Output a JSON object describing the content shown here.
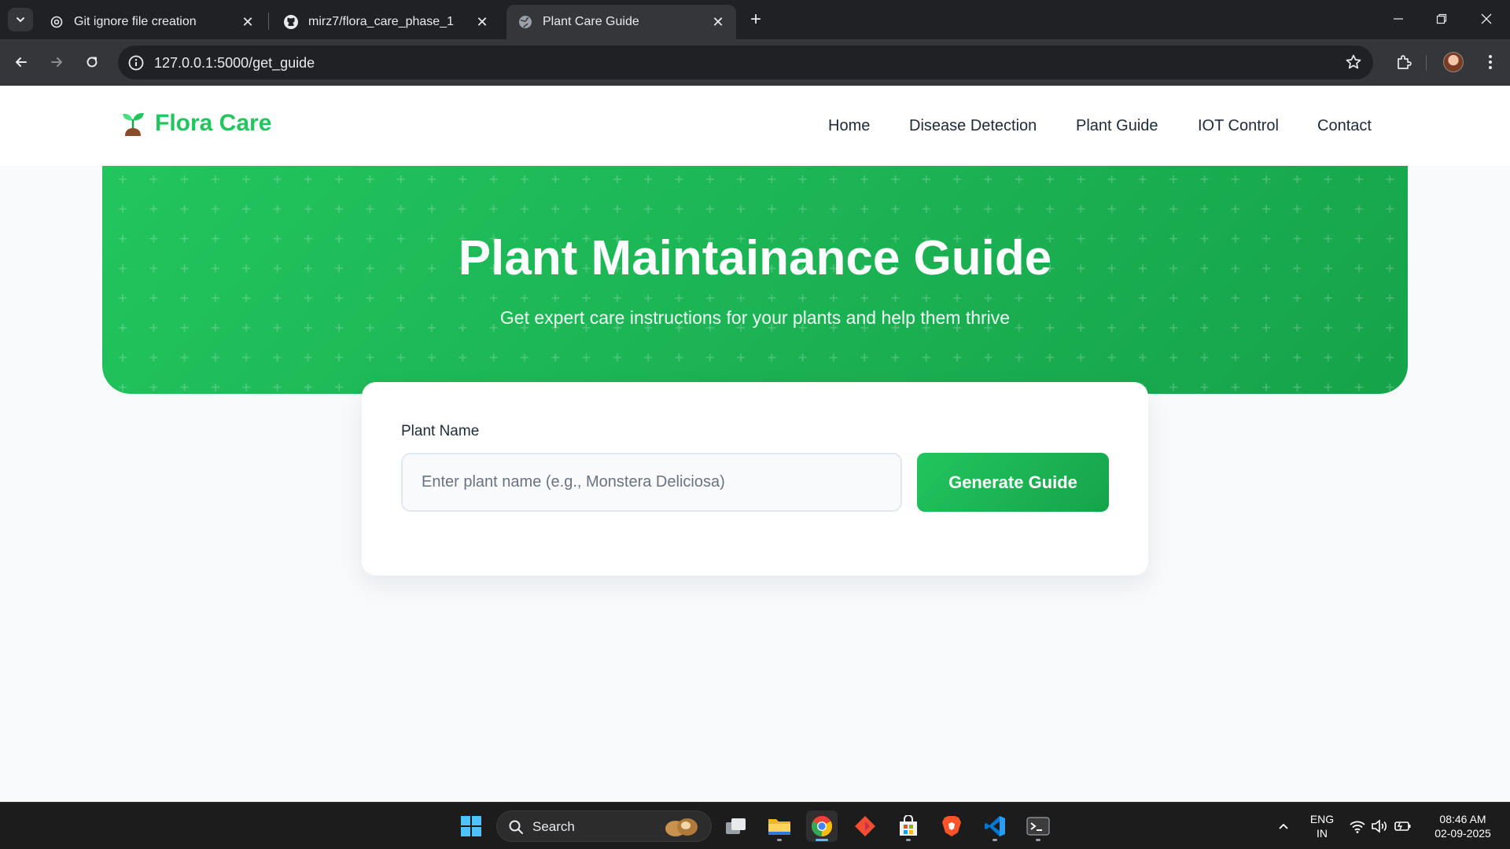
{
  "browser": {
    "tabs": [
      {
        "label": "Git ignore file creation",
        "icon": "openai-icon",
        "active": false
      },
      {
        "label": "mirz7/flora_care_phase_1",
        "icon": "github-icon",
        "active": false
      },
      {
        "label": "Plant Care Guide",
        "icon": "globe-icon",
        "active": true
      }
    ],
    "url": "127.0.0.1:5000/get_guide"
  },
  "site": {
    "brand": "Flora Care",
    "nav": [
      "Home",
      "Disease Detection",
      "Plant Guide",
      "IOT Control",
      "Contact"
    ],
    "hero": {
      "title": "Plant Maintainance Guide",
      "subtitle": "Get expert care instructions for your plants and help them thrive"
    },
    "form": {
      "label": "Plant Name",
      "placeholder": "Enter plant name (e.g., Monstera Deliciosa)",
      "value": "",
      "button": "Generate Guide"
    }
  },
  "colors": {
    "brand_green": "#22c55e",
    "hero_gradient_end": "#16a34a",
    "chrome_dark": "#202124",
    "taskbar": "#1c1c1c"
  },
  "taskbar": {
    "search_label": "Search",
    "apps": [
      "windows-start-icon",
      "task-view-icon",
      "file-explorer-icon",
      "chrome-icon",
      "git-app-icon",
      "ms-store-icon",
      "brave-icon",
      "vscode-icon",
      "terminal-icon"
    ],
    "tray": {
      "lang_line1": "ENG",
      "lang_line2": "IN",
      "time": "08:46 AM",
      "date": "02-09-2025"
    }
  }
}
